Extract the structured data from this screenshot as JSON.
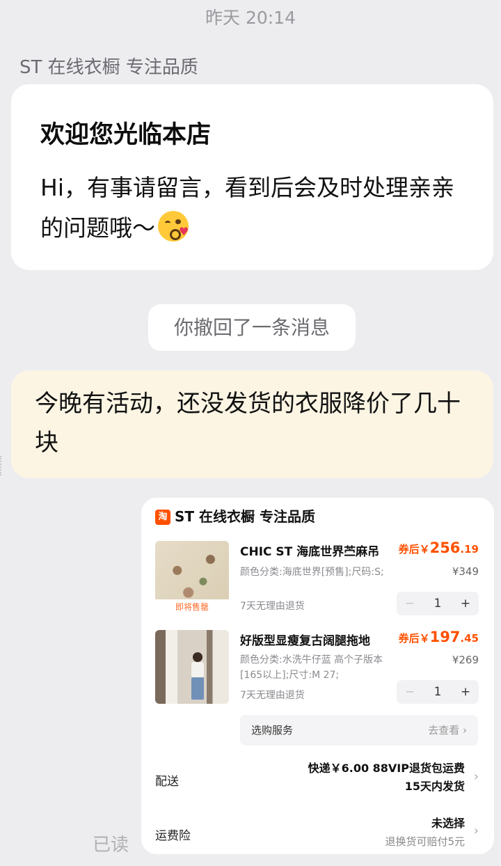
{
  "chat": {
    "timestamp": "昨天 20:14",
    "sender_name": "ST 在线衣橱 专注品质",
    "welcome": {
      "title": "欢迎您光临本店",
      "body": "Hi，有事请留言，看到后会及时处理亲亲的问题哦～"
    },
    "recall_notice": "你撤回了一条消息",
    "message": "今晚有活动，还没发货的衣服降价了几十块",
    "read_status": "已读"
  },
  "order_card": {
    "shop_logo": "淘",
    "shop_name": "ST 在线衣橱 专注品质",
    "items": [
      {
        "title": "CHIC ST 海底世界苎麻吊",
        "price_prefix": "券后￥",
        "price_int": "256",
        "price_dec": ".19",
        "variant": "颜色分类:海底世界[预售];尺码:S;",
        "original_price": "¥349",
        "return_policy": "7天无理由退货",
        "quantity": "1",
        "thumb_badge": "即将售罄"
      },
      {
        "title": "好版型显瘦复古阔腿拖地",
        "price_prefix": "券后￥",
        "price_int": "197",
        "price_dec": ".45",
        "variant": "颜色分类:水洗牛仔蓝 高个子版本[165以上];尺寸:M 27;",
        "original_price": "¥269",
        "return_policy": "7天无理由退货",
        "quantity": "1"
      }
    ],
    "service": {
      "label": "选购服务",
      "action": "去查看 ›"
    },
    "delivery": {
      "label": "配送",
      "line1": "快递￥6.00 88VIP退货包运费",
      "line2": "15天内发货"
    },
    "insurance": {
      "label": "运费险",
      "line1": "未选择",
      "line2": "退换货可赔付5元"
    },
    "stepper": {
      "minus": "−",
      "plus": "+"
    },
    "chevron": "›"
  }
}
